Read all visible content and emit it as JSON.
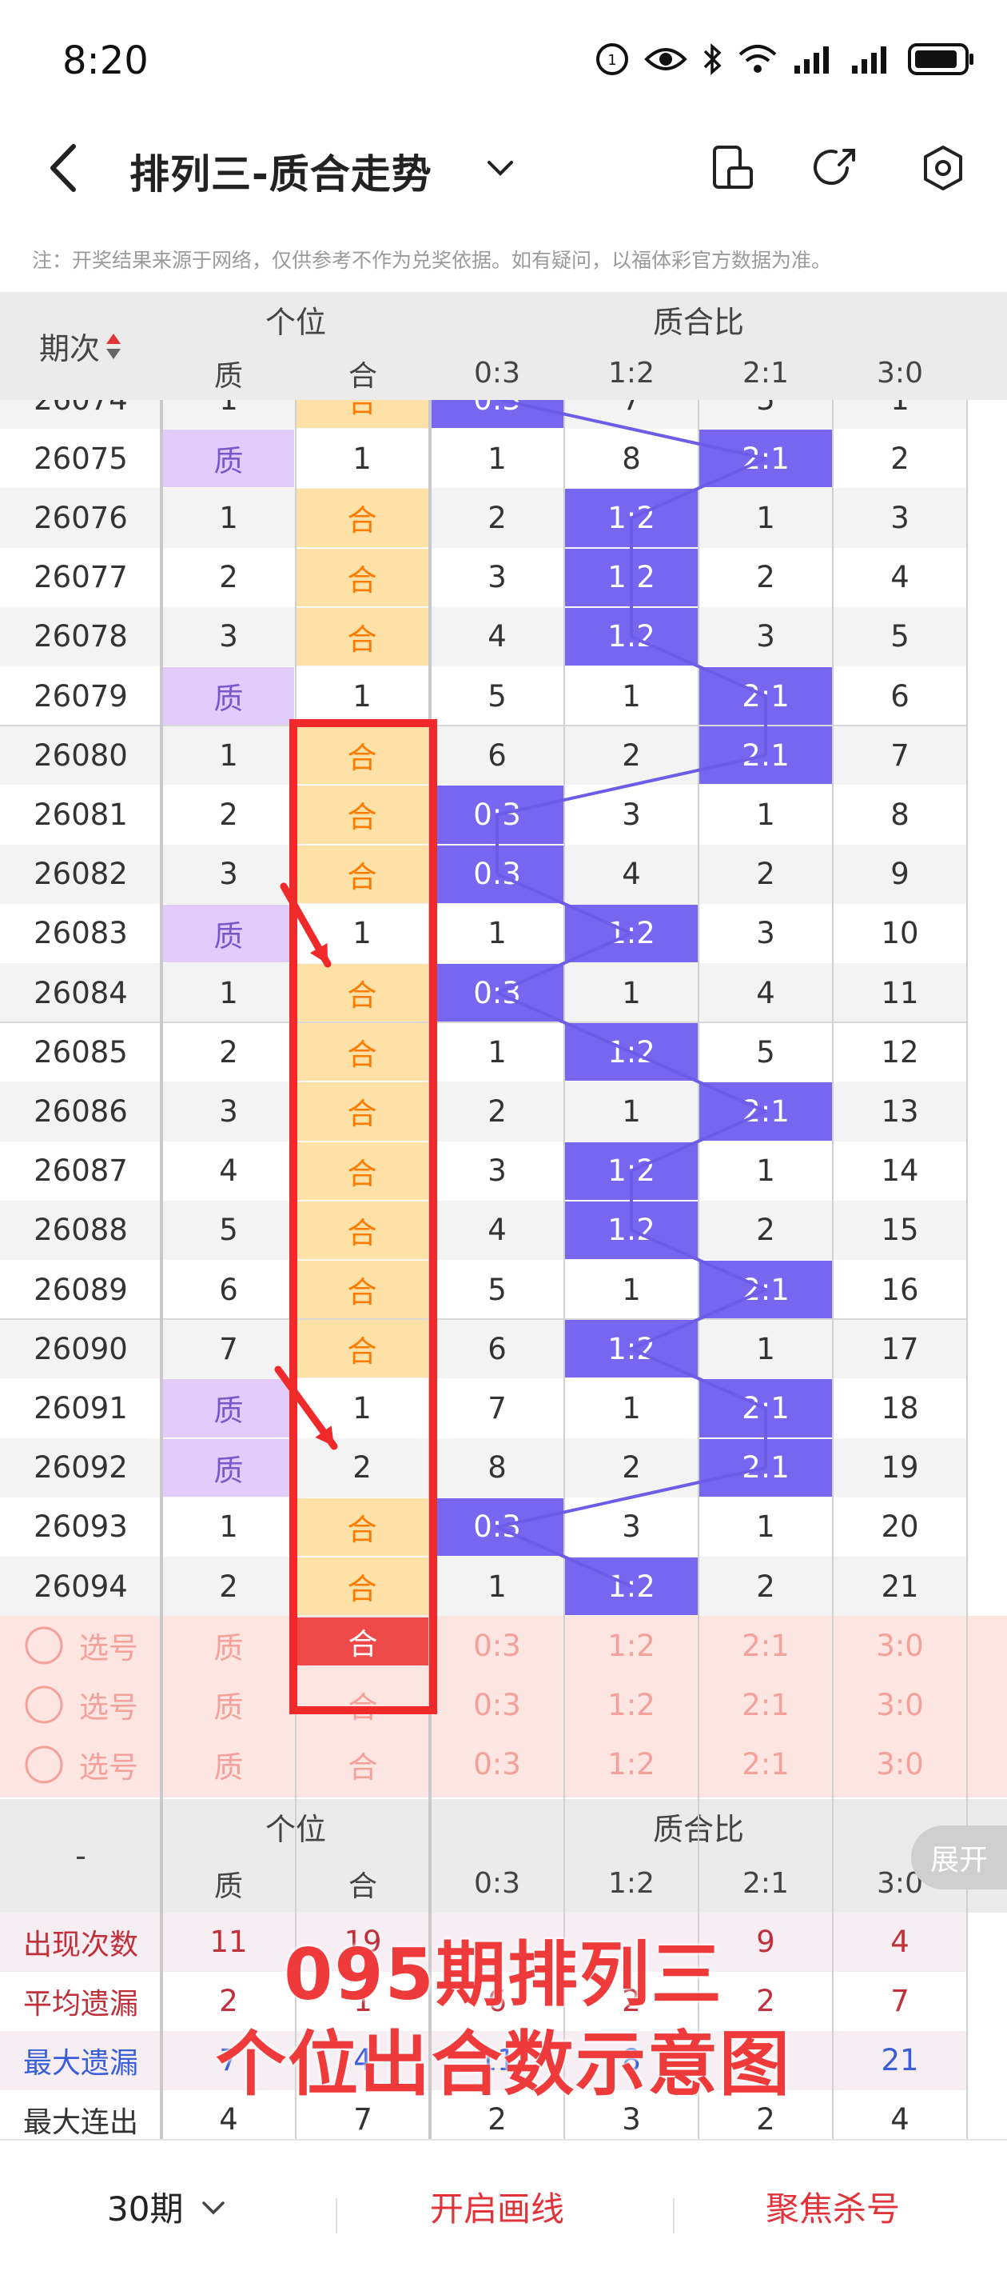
{
  "status_bar": {
    "time": "8:20",
    "battery_icon": "battery-icon",
    "signal_icon": "signal-icon",
    "wifi_icon": "wifi-icon"
  },
  "title_bar": {
    "title": "排列三-质合走势",
    "back_icon": "back-chevron-icon",
    "dropdown_icon": "chevron-down-icon"
  },
  "notice": "注：开奖结果来源于网络，仅供参考不作为兑奖依据。如有疑问，以福体彩官方数据为准。",
  "table": {
    "period_header": "期次",
    "group_pos": "个位",
    "group_ratio": "质合比",
    "sub_pos": [
      "质",
      "合"
    ],
    "sub_ratio": [
      "0:3",
      "1:2",
      "2:1",
      "3:0"
    ],
    "rows": [
      {
        "period": "26074",
        "zhi": "1",
        "he": "合",
        "pos": "he",
        "r": [
          "0:3",
          "7",
          "5",
          "1"
        ],
        "ratio_hit": 0
      },
      {
        "period": "26075",
        "zhi": "质",
        "he": "1",
        "pos": "zhi",
        "r": [
          "1",
          "8",
          "2:1",
          "2"
        ],
        "ratio_hit": 2
      },
      {
        "period": "26076",
        "zhi": "1",
        "he": "合",
        "pos": "he",
        "r": [
          "2",
          "1:2",
          "1",
          "3"
        ],
        "ratio_hit": 1
      },
      {
        "period": "26077",
        "zhi": "2",
        "he": "合",
        "pos": "he",
        "r": [
          "3",
          "1:2",
          "2",
          "4"
        ],
        "ratio_hit": 1
      },
      {
        "period": "26078",
        "zhi": "3",
        "he": "合",
        "pos": "he",
        "r": [
          "4",
          "1:2",
          "3",
          "5"
        ],
        "ratio_hit": 1
      },
      {
        "period": "26079",
        "zhi": "质",
        "he": "1",
        "pos": "zhi",
        "r": [
          "5",
          "1",
          "2:1",
          "6"
        ],
        "ratio_hit": 2
      },
      {
        "period": "26080",
        "zhi": "1",
        "he": "合",
        "pos": "he",
        "r": [
          "6",
          "2",
          "2:1",
          "7"
        ],
        "ratio_hit": 2
      },
      {
        "period": "26081",
        "zhi": "2",
        "he": "合",
        "pos": "he",
        "r": [
          "0:3",
          "3",
          "1",
          "8"
        ],
        "ratio_hit": 0
      },
      {
        "period": "26082",
        "zhi": "3",
        "he": "合",
        "pos": "he",
        "r": [
          "0:3",
          "4",
          "2",
          "9"
        ],
        "ratio_hit": 0
      },
      {
        "period": "26083",
        "zhi": "质",
        "he": "1",
        "pos": "zhi",
        "r": [
          "1",
          "1:2",
          "3",
          "10"
        ],
        "ratio_hit": 1
      },
      {
        "period": "26084",
        "zhi": "1",
        "he": "合",
        "pos": "he",
        "r": [
          "0:3",
          "1",
          "4",
          "11"
        ],
        "ratio_hit": 0
      },
      {
        "period": "26085",
        "zhi": "2",
        "he": "合",
        "pos": "he",
        "r": [
          "1",
          "1:2",
          "5",
          "12"
        ],
        "ratio_hit": 1
      },
      {
        "period": "26086",
        "zhi": "3",
        "he": "合",
        "pos": "he",
        "r": [
          "2",
          "1",
          "2:1",
          "13"
        ],
        "ratio_hit": 2
      },
      {
        "period": "26087",
        "zhi": "4",
        "he": "合",
        "pos": "he",
        "r": [
          "3",
          "1:2",
          "1",
          "14"
        ],
        "ratio_hit": 1
      },
      {
        "period": "26088",
        "zhi": "5",
        "he": "合",
        "pos": "he",
        "r": [
          "4",
          "1:2",
          "2",
          "15"
        ],
        "ratio_hit": 1
      },
      {
        "period": "26089",
        "zhi": "6",
        "he": "合",
        "pos": "he",
        "r": [
          "5",
          "1",
          "2:1",
          "16"
        ],
        "ratio_hit": 2
      },
      {
        "period": "26090",
        "zhi": "7",
        "he": "合",
        "pos": "he",
        "r": [
          "6",
          "1:2",
          "1",
          "17"
        ],
        "ratio_hit": 1
      },
      {
        "period": "26091",
        "zhi": "质",
        "he": "1",
        "pos": "zhi",
        "r": [
          "7",
          "1",
          "2:1",
          "18"
        ],
        "ratio_hit": 2
      },
      {
        "period": "26092",
        "zhi": "质",
        "he": "2",
        "pos": "zhi",
        "r": [
          "8",
          "2",
          "2:1",
          "19"
        ],
        "ratio_hit": 2
      },
      {
        "period": "26093",
        "zhi": "1",
        "he": "合",
        "pos": "he",
        "r": [
          "0:3",
          "3",
          "1",
          "20"
        ],
        "ratio_hit": 0
      },
      {
        "period": "26094",
        "zhi": "2",
        "he": "合",
        "pos": "he",
        "r": [
          "1",
          "1:2",
          "2",
          "21"
        ],
        "ratio_hit": 1
      }
    ],
    "select_rows": [
      {
        "label": "选号",
        "cells": [
          "质",
          "合",
          "0:3",
          "1:2",
          "2:1",
          "3:0"
        ],
        "he_selected": true
      },
      {
        "label": "选号",
        "cells": [
          "质",
          "合",
          "0:3",
          "1:2",
          "2:1",
          "3:0"
        ],
        "he_selected": false
      },
      {
        "label": "选号",
        "cells": [
          "质",
          "合",
          "0:3",
          "1:2",
          "2:1",
          "3:0"
        ],
        "he_selected": false
      }
    ],
    "footer_header": {
      "dash": "-",
      "group_pos": "个位",
      "group_ratio": "质合比",
      "sub": [
        "质",
        "合",
        "0:3",
        "1:2",
        "2:1",
        "3:0"
      ]
    },
    "stats": [
      {
        "label": "出现次数",
        "values": [
          "11",
          "19",
          "",
          "",
          "9",
          "4"
        ],
        "style": "red"
      },
      {
        "label": "平均遗漏",
        "values": [
          "2",
          "1",
          "6",
          "2",
          "2",
          "7"
        ],
        "style": "red"
      },
      {
        "label": "最大遗漏",
        "values": [
          "7",
          "4",
          "11",
          "8",
          "",
          "21"
        ],
        "style": "blue"
      },
      {
        "label": "最大连出",
        "values": [
          "4",
          "7",
          "2",
          "3",
          "2",
          "4"
        ],
        "style": "dark"
      }
    ]
  },
  "expand_button": "展开",
  "caption_line1": "095期排列三",
  "caption_line2": "个位出合数示意图",
  "bottom_bar": {
    "periods": "30期",
    "draw_lines": "开启画线",
    "focus_kill": "聚焦杀号"
  }
}
